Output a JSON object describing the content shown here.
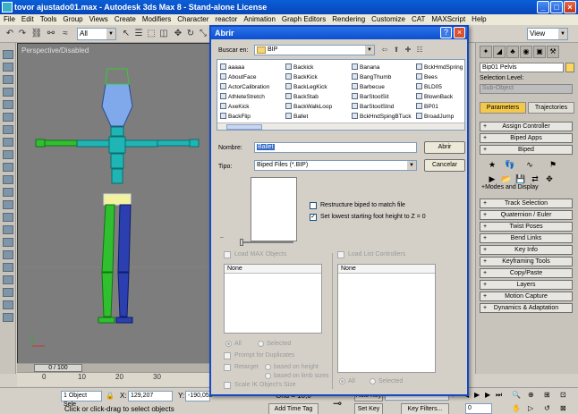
{
  "window": {
    "title": "tovor ajustado01.max - Autodesk 3ds Max 8 - Stand-alone License",
    "min": "_",
    "max": "□",
    "close": "×"
  },
  "menu": [
    "File",
    "Edit",
    "Tools",
    "Group",
    "Views",
    "Create",
    "Modifiers",
    "Character",
    "reactor",
    "Animation",
    "Graph Editors",
    "Rendering",
    "Customize",
    "CAT",
    "MAXScript",
    "Help"
  ],
  "toolbar": {
    "selection_filter": "All",
    "view_select": "View"
  },
  "viewport": {
    "label": "Perspective/Disabled"
  },
  "command_panel": {
    "object_name": "Bip01 Pelvis",
    "selection_level_label": "Selection Level:",
    "sub_object": "Sub-Object",
    "tab_parameters": "Parameters",
    "tab_trajectories": "Trajectories",
    "rollouts_top": [
      "Assign Controller",
      "Biped Apps"
    ],
    "biped_rollout": "Biped",
    "modes_label": "+Modes and Display",
    "rollouts_bottom": [
      "Track Selection",
      "Quaternion / Euler",
      "Twist Poses",
      "Bend Links",
      "Key Info",
      "Keyframing Tools",
      "Copy/Paste",
      "Layers",
      "Motion Capture",
      "Dynamics & Adaptation"
    ],
    "pm": "+"
  },
  "timeline": {
    "frame_indicator": "0 / 100",
    "ticks": [
      "0",
      "10",
      "20",
      "30"
    ]
  },
  "status": {
    "selection": "1 Object Sele",
    "x_label": "X:",
    "x_value": "129,207",
    "y_label": "Y:",
    "y_value": "-190,052",
    "grid": "Grid = 10,0",
    "prompt": "Click or click-drag to select objects",
    "add_time_tag": "Add Time Tag",
    "auto_key": "Auto Key",
    "selected": "Selected",
    "set_key": "Set Key",
    "key_filters": "Key Filters...",
    "frame": "0"
  },
  "dialog": {
    "title": "Abrir",
    "help": "?",
    "close": "×",
    "look_in_label": "Buscar en:",
    "look_in_value": "BIP",
    "files": [
      [
        "aaaaa",
        "AboutFace",
        "ActorCalibration",
        "AthleteStretch",
        "AxeKick",
        "BackFlip"
      ],
      [
        "Backick",
        "BackKick",
        "BackLegKick",
        "BackStab",
        "BackWalkLoop",
        "Ballet"
      ],
      [
        "Banana",
        "BangThumb",
        "Barbecue",
        "BarStoolSit",
        "BarStoolStnd",
        "BckHndSpingBTuck"
      ],
      [
        "BckHmdSpring",
        "Bees",
        "BLD05",
        "BlownBack",
        "BP01",
        "BroadJump"
      ]
    ],
    "file_name_label": "Nombre:",
    "file_name_value": "Ballet",
    "file_type_label": "Tipo:",
    "file_type_value": "Biped Files (*.BIP)",
    "open_button": "Abrir",
    "cancel_button": "Cancelar",
    "restructure_label": "Restructure biped to match file",
    "set_lowest_label": "Set lowest starting foot height to Z = 0",
    "set_lowest_checked": "✓",
    "preview_dash": "–",
    "load_max_objects": "Load MAX Objects",
    "load_list_controllers": "Load List Controllers",
    "none_header_left": "None",
    "none_header_right": "None",
    "radio_all": "All",
    "radio_selected": "Selected",
    "prompt_duplicates": "Prompt for Duplicates",
    "retarget": "Retarget",
    "based_on_height": "based on height",
    "based_on_limb": "based on limb sizes",
    "scale_ik": "Scale IK Object's Size",
    "radio_all_right": "All",
    "radio_selected_right": "Selected"
  }
}
